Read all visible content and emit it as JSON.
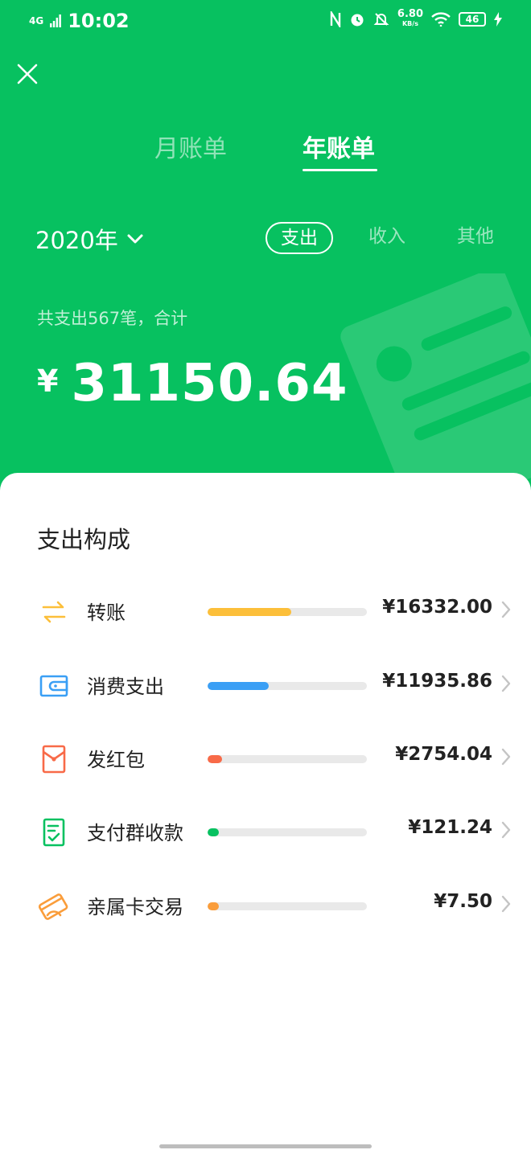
{
  "status": {
    "network": "4G",
    "time": "10:02",
    "speed": "6.80",
    "speed_unit": "KB/s",
    "battery": "46"
  },
  "tabs": [
    {
      "label": "月账单",
      "active": false
    },
    {
      "label": "年账单",
      "active": true
    }
  ],
  "year_select": {
    "label": "2020年"
  },
  "filters": [
    {
      "label": "支出",
      "active": true
    },
    {
      "label": "收入",
      "active": false
    },
    {
      "label": "其他",
      "active": false
    }
  ],
  "summary": {
    "text": "共支出567笔，合计",
    "currency": "¥",
    "total": "31150.64"
  },
  "breakdown": {
    "title": "支出构成",
    "items": [
      {
        "label": "转账",
        "amount": "¥16332.00",
        "value": 16332.0,
        "color": "#fcbf3a",
        "icon": "transfer-icon"
      },
      {
        "label": "消费支出",
        "amount": "¥11935.86",
        "value": 11935.86,
        "color": "#3a9ff5",
        "icon": "wallet-icon"
      },
      {
        "label": "发红包",
        "amount": "¥2754.04",
        "value": 2754.04,
        "color": "#f86a48",
        "icon": "red-packet-icon"
      },
      {
        "label": "支付群收款",
        "amount": "¥121.24",
        "value": 121.24,
        "color": "#07c160",
        "icon": "group-payment-icon"
      },
      {
        "label": "亲属卡交易",
        "amount": "¥7.50",
        "value": 7.5,
        "color": "#fa9d3b",
        "icon": "family-card-icon"
      }
    ]
  },
  "colors": {
    "brand": "#07c160"
  }
}
